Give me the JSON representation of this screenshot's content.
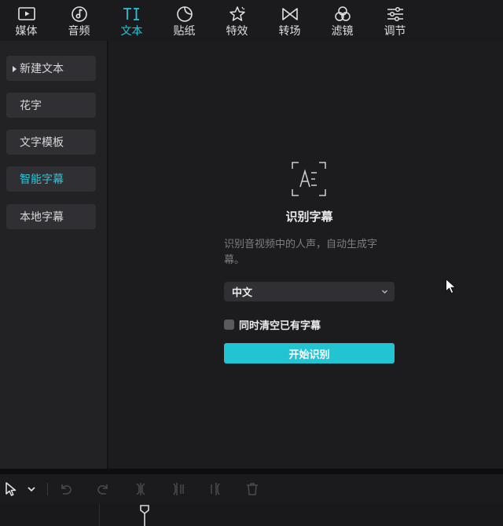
{
  "toolbar": {
    "items": [
      {
        "label": "媒体",
        "icon": "media-icon"
      },
      {
        "label": "音频",
        "icon": "audio-icon"
      },
      {
        "label": "文本",
        "icon": "text-icon",
        "active": true
      },
      {
        "label": "贴纸",
        "icon": "sticker-icon"
      },
      {
        "label": "特效",
        "icon": "effects-icon"
      },
      {
        "label": "转场",
        "icon": "transition-icon"
      },
      {
        "label": "滤镜",
        "icon": "filter-icon"
      },
      {
        "label": "调节",
        "icon": "adjust-icon"
      }
    ]
  },
  "sidebar": {
    "items": [
      {
        "label": "新建文本"
      },
      {
        "label": "花字"
      },
      {
        "label": "文字模板"
      },
      {
        "label": "智能字幕",
        "active": true
      },
      {
        "label": "本地字幕"
      }
    ]
  },
  "subtitle_panel": {
    "title": "识别字幕",
    "description": "识别音视频中的人声，自动生成字幕。",
    "language": "中文",
    "clear_existing_label": "同时清空已有字幕",
    "clear_existing_checked": false,
    "start_button": "开始识别"
  },
  "colors": {
    "accent": "#26c6da",
    "button": "#22c3d3",
    "panel": "#1c1c1f",
    "sidebar": "#222225",
    "toolbar": "#1b1b1e"
  }
}
